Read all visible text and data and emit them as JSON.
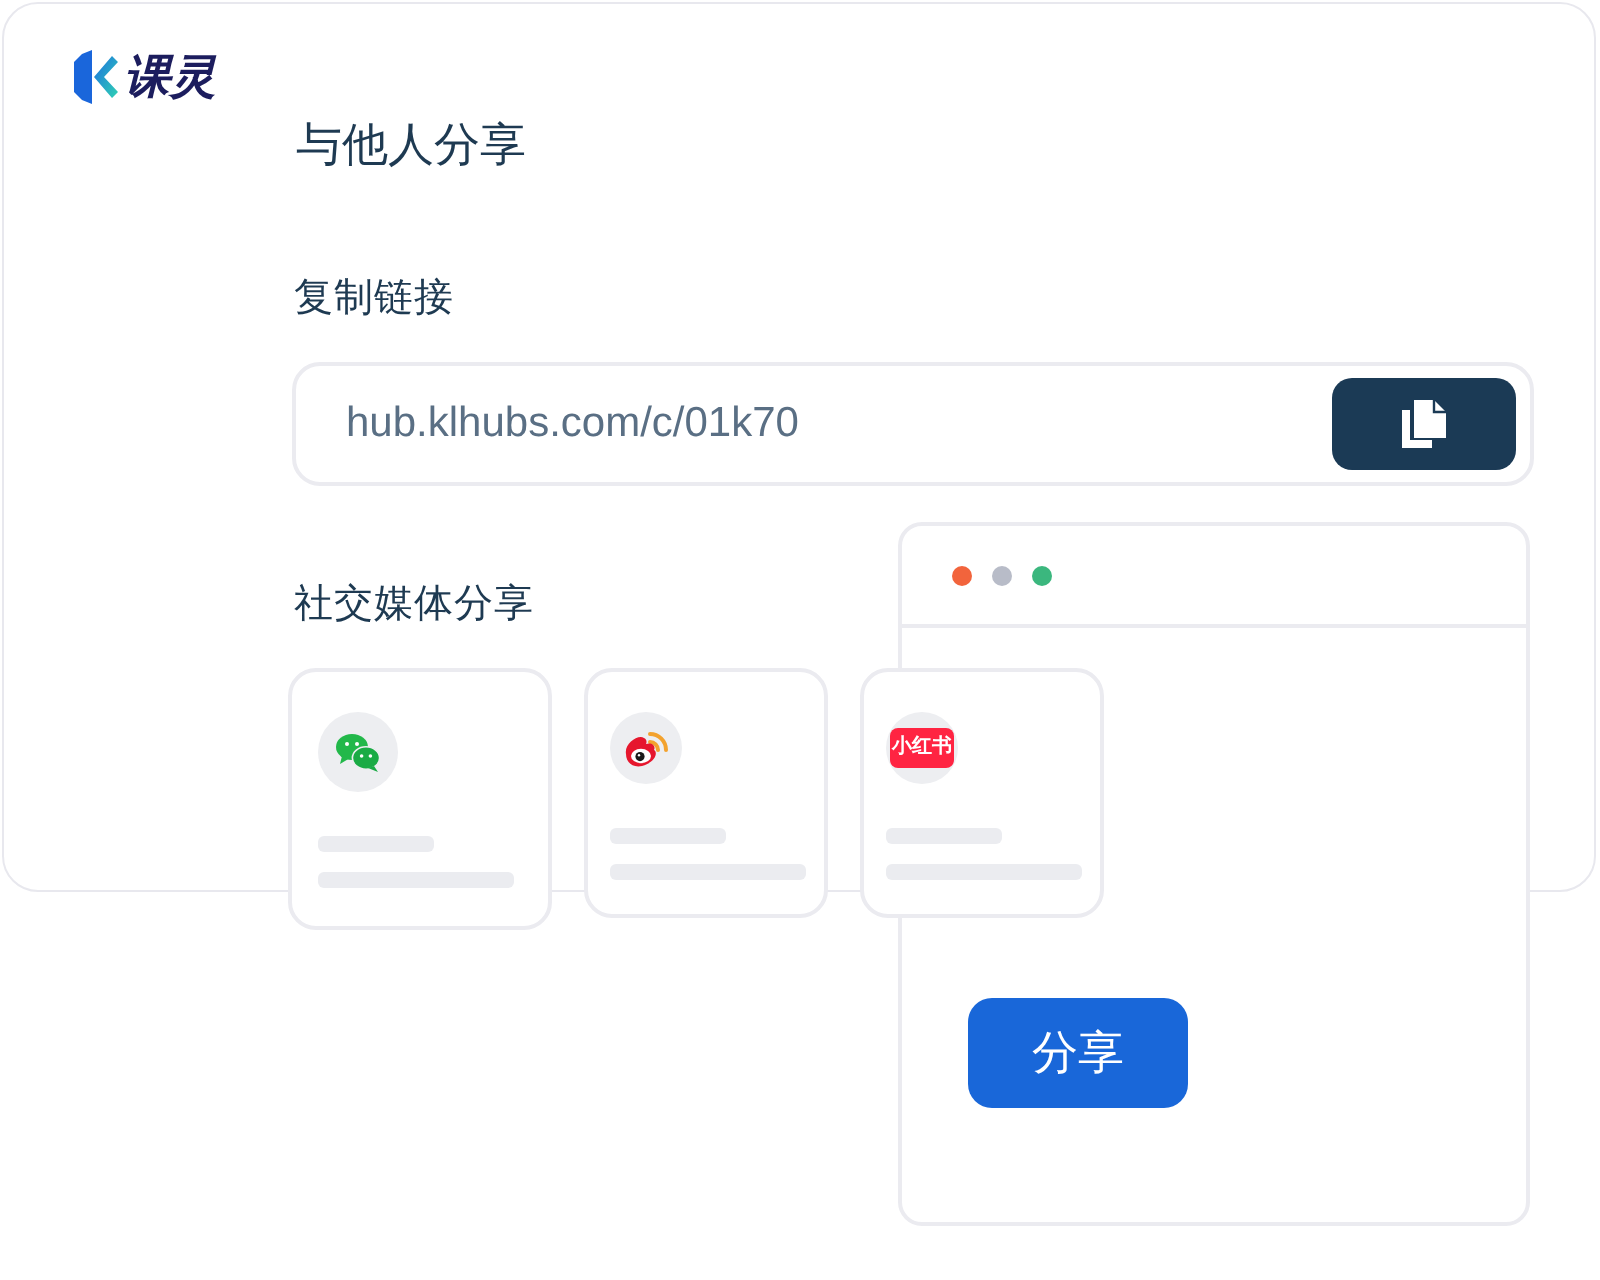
{
  "logo": {
    "text": "课灵"
  },
  "title": "与他人分享",
  "copy_link": {
    "label": "复制链接",
    "value": "hub.klhubs.com/c/01k70"
  },
  "social": {
    "label": "社交媒体分享",
    "cards": [
      {
        "kind": "wechat"
      },
      {
        "kind": "weibo"
      },
      {
        "kind": "xiaohongshu",
        "logo_text": "小红书"
      }
    ]
  },
  "browser_window": {
    "dots": [
      {
        "color": "#f2643c"
      },
      {
        "color": "#b8bcc8"
      },
      {
        "color": "#3bb77e"
      }
    ],
    "button": "分享"
  }
}
